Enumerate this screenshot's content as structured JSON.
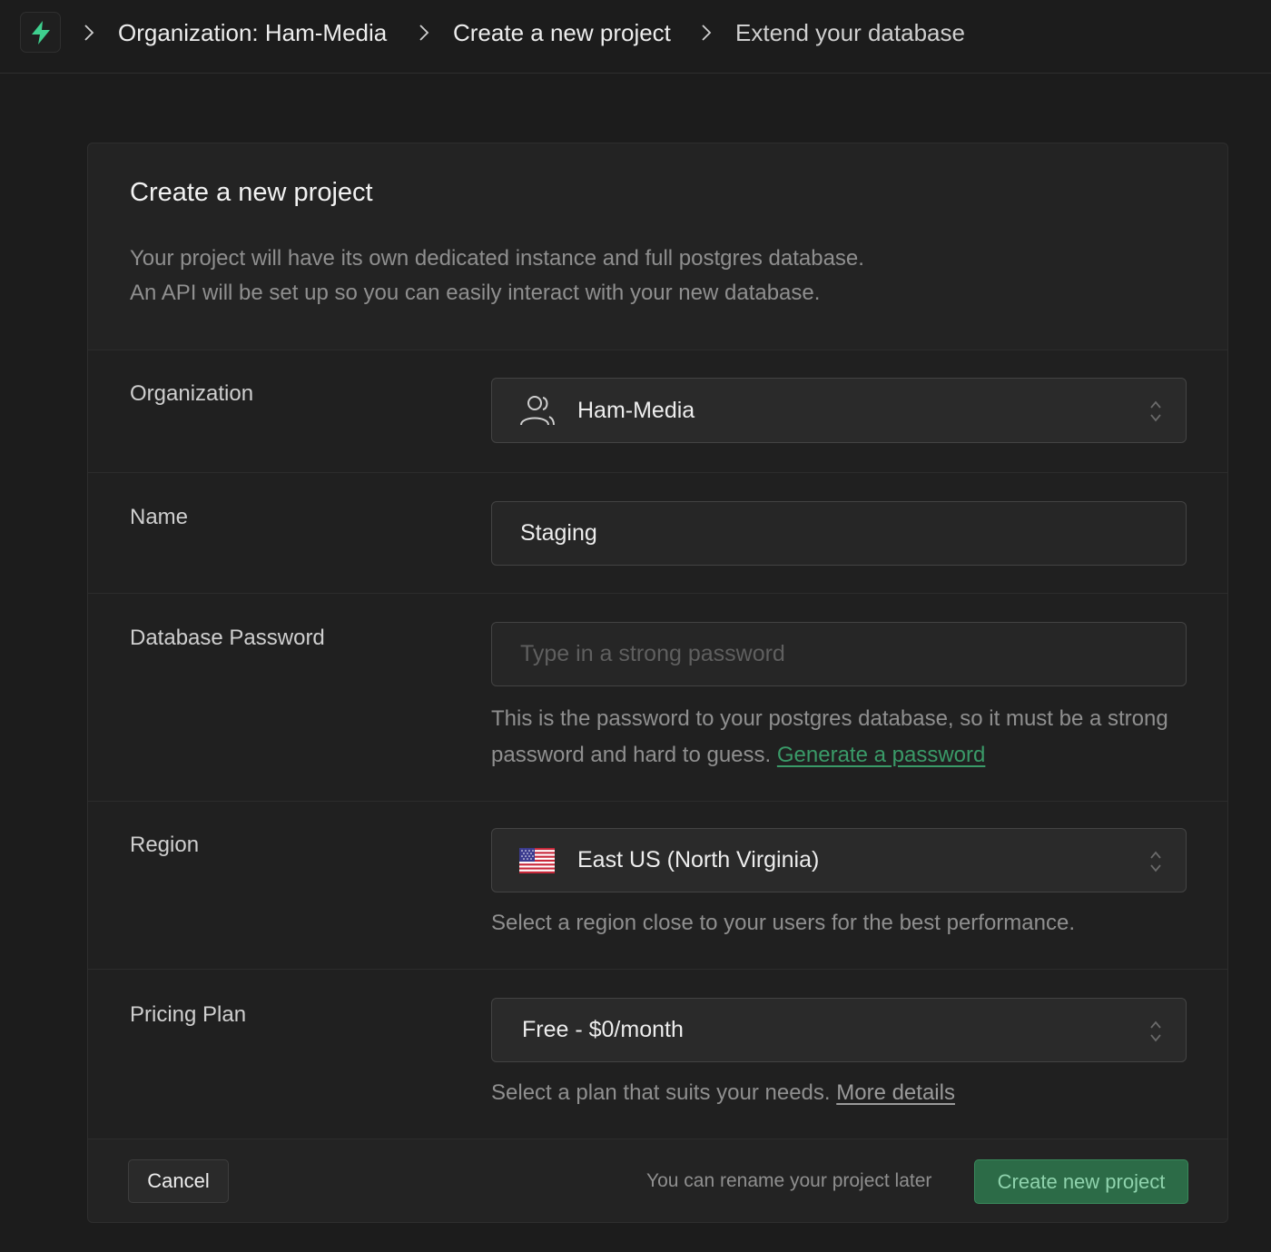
{
  "breadcrumb": {
    "items": [
      "Organization: Ham-Media",
      "Create a new project",
      "Extend your database"
    ]
  },
  "brand": {
    "icon": "bolt-icon",
    "accent": "#3ecf8e"
  },
  "card": {
    "title": "Create a new project",
    "description_line1": "Your project will have its own dedicated instance and full postgres database.",
    "description_line2": "An API will be set up so you can easily interact with your new database."
  },
  "form": {
    "organization": {
      "label": "Organization",
      "value": "Ham-Media",
      "icon": "users-icon"
    },
    "name": {
      "label": "Name",
      "value": "Staging"
    },
    "password": {
      "label": "Database Password",
      "placeholder": "Type in a strong password",
      "help": "This is the password to your postgres database, so it must be a strong password and hard to guess.",
      "link": "Generate a password"
    },
    "region": {
      "label": "Region",
      "value": "East US (North Virginia)",
      "icon": "us-flag-icon",
      "help": "Select a region close to your users for the best performance."
    },
    "plan": {
      "label": "Pricing Plan",
      "value": "Free - $0/month",
      "help": "Select a plan that suits your needs.",
      "link": "More details"
    }
  },
  "footer": {
    "cancel_label": "Cancel",
    "note": "You can rename your project later",
    "create_label": "Create new project"
  }
}
